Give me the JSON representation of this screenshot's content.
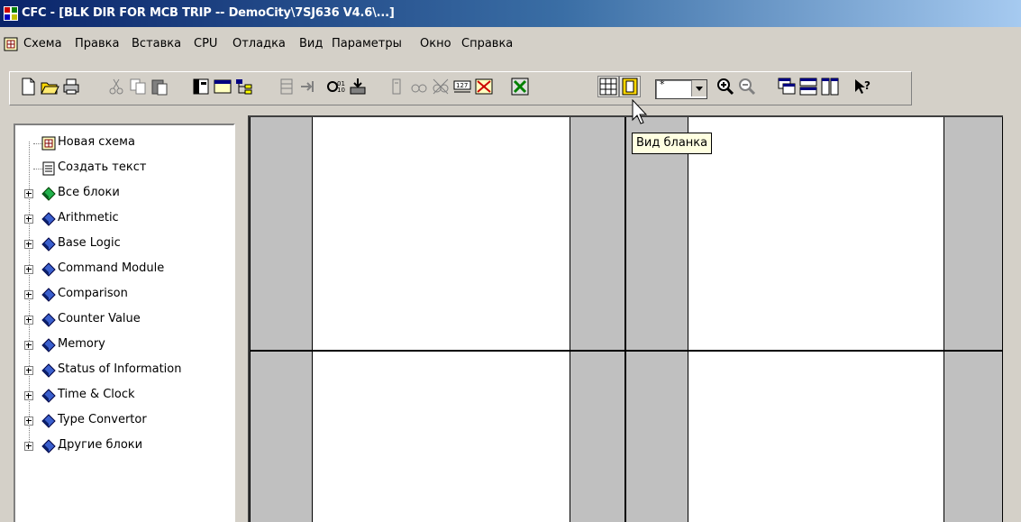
{
  "window": {
    "title": "CFC - [BLK DIR FOR MCB TRIP -- DemoCity\\7SJ636 V4.6\\...]",
    "app_icon": "cfc-app-icon"
  },
  "menu": {
    "items": [
      "Схема",
      "Правка",
      "Вставка",
      "CPU",
      "Отладка",
      "Вид",
      "Параметры",
      "Окно",
      "Справка"
    ]
  },
  "toolbar": {
    "zoom_combo_value": "*",
    "buttons": [
      "new",
      "open",
      "print",
      "cut",
      "copy",
      "paste",
      "catalog",
      "overview",
      "tree",
      "insert",
      "step",
      "compile",
      "download",
      "watch",
      "eye",
      "cross",
      "counter",
      "dial",
      "fit",
      "sheet-view",
      "form-view",
      "zoom-in",
      "zoom-out",
      "window1",
      "window2",
      "window3",
      "help"
    ]
  },
  "tree": {
    "items": [
      {
        "label": "Новая схема",
        "icon": "new-chart-icon",
        "expandable": false
      },
      {
        "label": "Создать текст",
        "icon": "text-doc-icon",
        "expandable": false
      },
      {
        "label": "Все блоки",
        "icon": "green-block-icon",
        "expandable": true
      },
      {
        "label": "Arithmetic",
        "icon": "blue-block-icon",
        "expandable": true
      },
      {
        "label": "Base Logic",
        "icon": "blue-block-icon",
        "expandable": true
      },
      {
        "label": "Command Module",
        "icon": "blue-block-icon",
        "expandable": true
      },
      {
        "label": "Comparison",
        "icon": "blue-block-icon",
        "expandable": true
      },
      {
        "label": "Counter Value",
        "icon": "blue-block-icon",
        "expandable": true
      },
      {
        "label": "Memory",
        "icon": "blue-block-icon",
        "expandable": true
      },
      {
        "label": "Status of Information",
        "icon": "blue-block-icon",
        "expandable": true
      },
      {
        "label": "Time & Clock",
        "icon": "blue-block-icon",
        "expandable": true
      },
      {
        "label": "Type Convertor",
        "icon": "blue-block-icon",
        "expandable": true
      },
      {
        "label": "Другие блоки",
        "icon": "blue-block-icon",
        "expandable": true
      }
    ]
  },
  "tooltip": {
    "text": "Вид бланка"
  },
  "colors": {
    "accent": "#0a246a",
    "chrome": "#d4d0c8",
    "sheet_gray": "#c0c0c0"
  }
}
